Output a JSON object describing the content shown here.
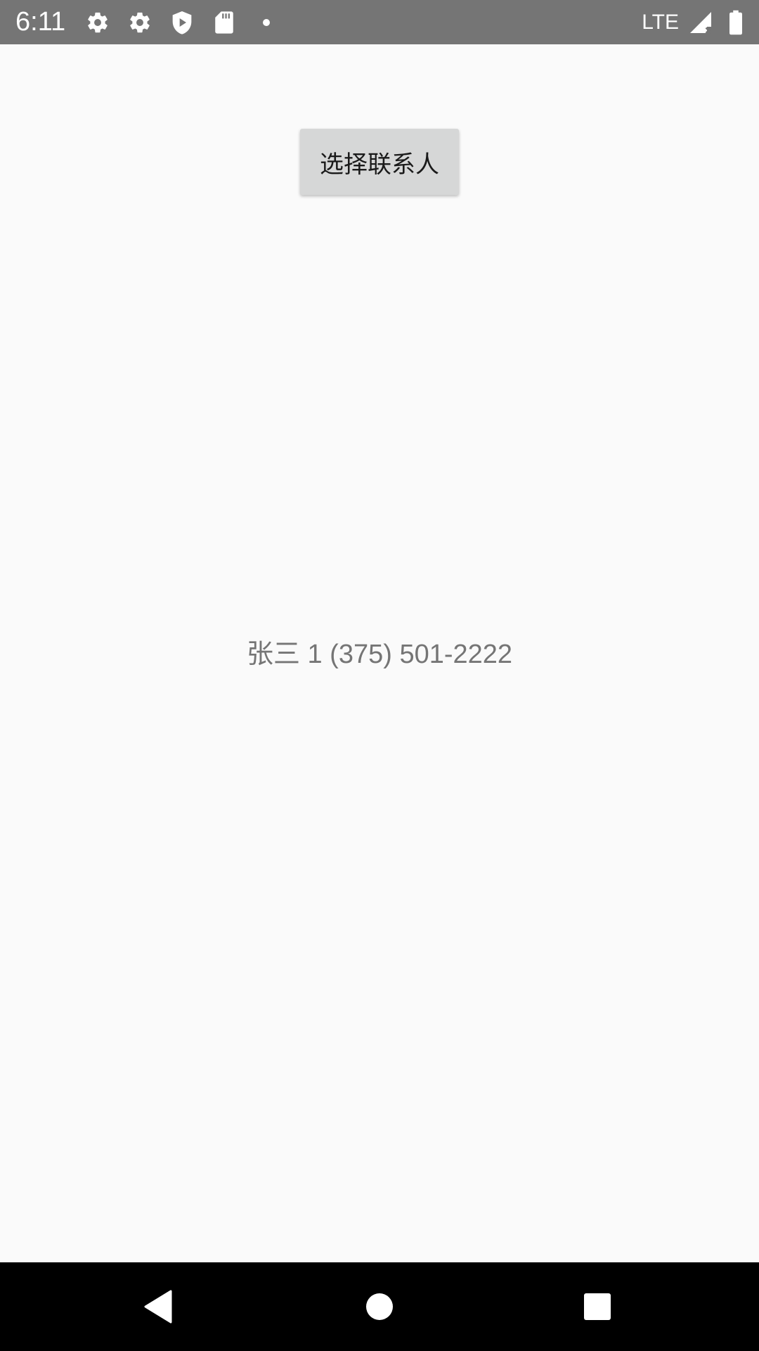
{
  "status_bar": {
    "time": "6:11",
    "network_label": "LTE",
    "icons_left": [
      "settings-icon",
      "settings-icon",
      "play-protect-icon",
      "sd-card-icon",
      "dot-icon"
    ],
    "icons_right": [
      "signal-icon",
      "battery-icon"
    ],
    "background_color": "#757575"
  },
  "main": {
    "pick_contact_button_label": "选择联系人",
    "contact_info": "张三 1 (375) 501-2222"
  },
  "nav_bar": {
    "buttons": [
      "back-icon",
      "home-icon",
      "recents-icon"
    ]
  },
  "colors": {
    "background": "#fafafa",
    "button_bg": "#d6d7d7",
    "contact_text": "#757575"
  }
}
